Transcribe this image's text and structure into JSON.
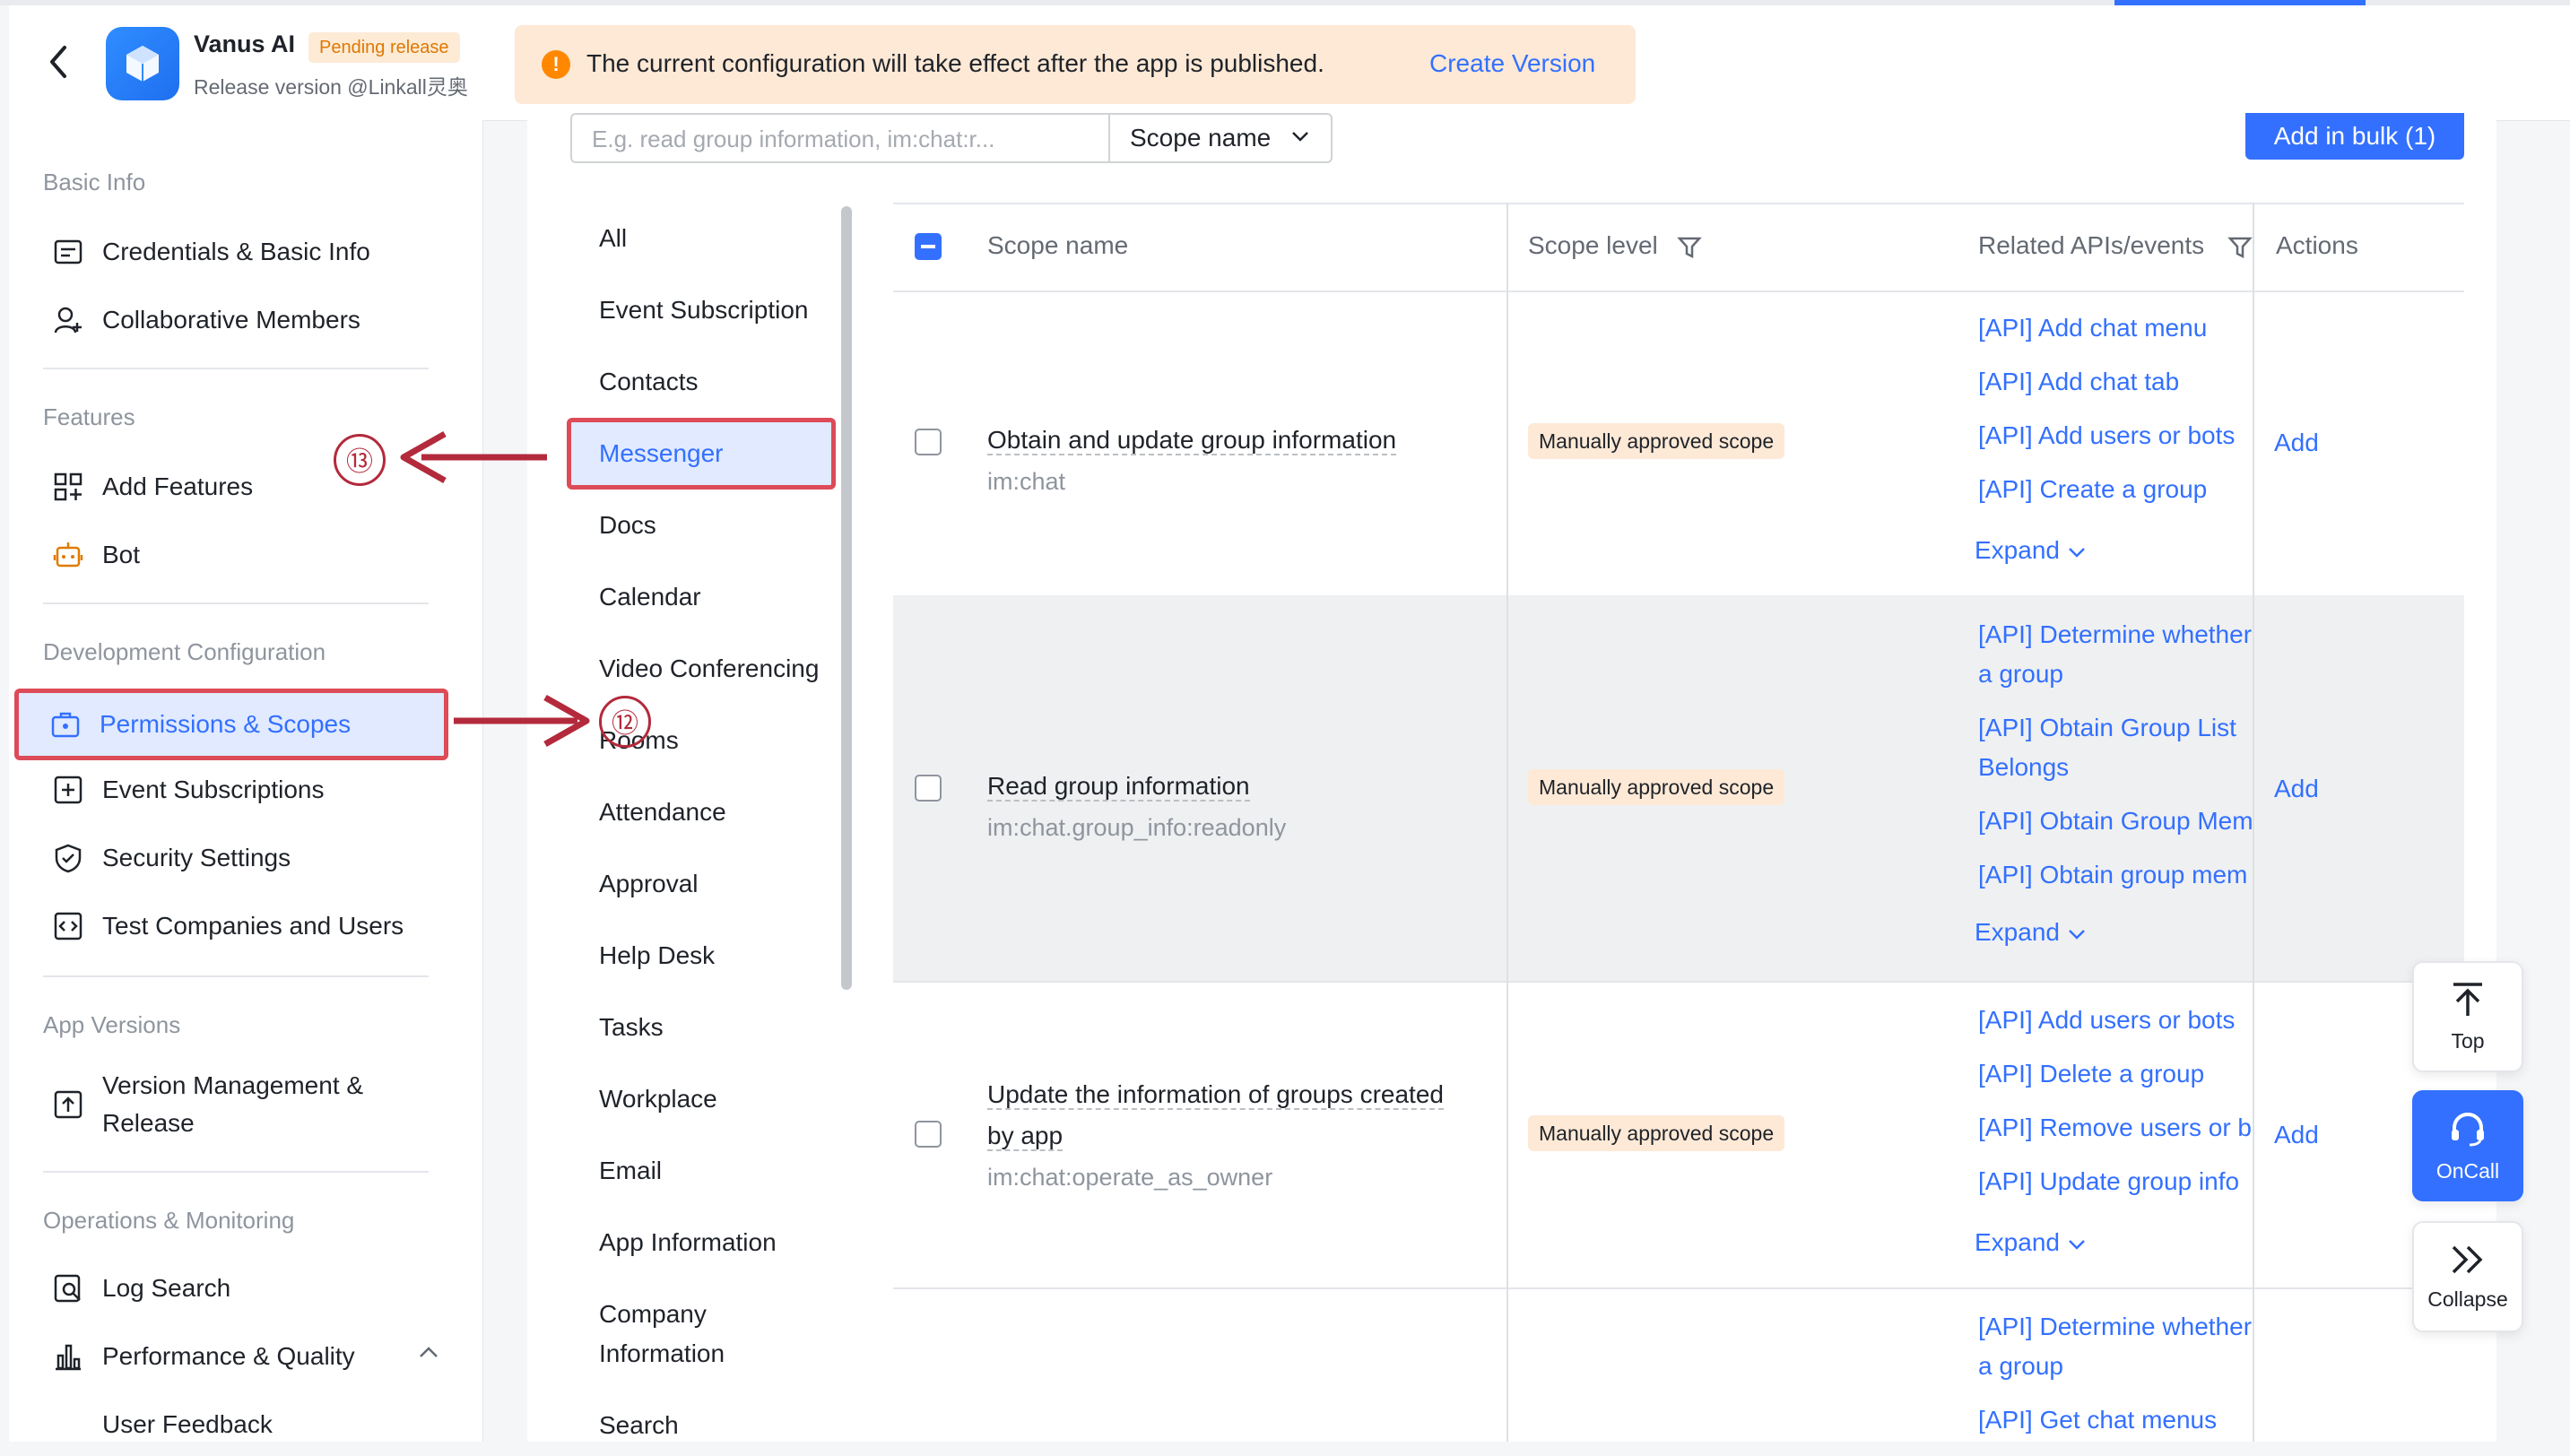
{
  "header": {
    "app_name": "Vanus AI",
    "status_badge": "Pending release",
    "release_info": "Release version @Linkall灵奥",
    "notice": "The current configuration will take effect after the app is published.",
    "create_version": "Create Version"
  },
  "sidebar": {
    "sections": [
      {
        "title": "Basic Info",
        "items": [
          {
            "label": "Credentials & Basic Info",
            "icon": "credentials-icon"
          },
          {
            "label": "Collaborative Members",
            "icon": "add-member-icon"
          }
        ]
      },
      {
        "title": "Features",
        "items": [
          {
            "label": "Add Features",
            "icon": "add-features-icon"
          },
          {
            "label": "Bot",
            "icon": "bot-icon"
          }
        ]
      },
      {
        "title": "Development Configuration",
        "items": [
          {
            "label": "Permissions & Scopes",
            "icon": "permissions-icon",
            "selected": true
          },
          {
            "label": "Event Subscriptions",
            "icon": "event-subscriptions-icon"
          },
          {
            "label": "Security Settings",
            "icon": "shield-icon"
          },
          {
            "label": "Test Companies and Users",
            "icon": "test-companies-icon"
          }
        ]
      },
      {
        "title": "App Versions",
        "items": [
          {
            "label": "Version Management & Release",
            "icon": "upload-icon"
          }
        ]
      },
      {
        "title": "Operations & Monitoring",
        "items": [
          {
            "label": "Log Search",
            "icon": "log-search-icon"
          },
          {
            "label": "Performance & Quality",
            "icon": "bar-chart-icon"
          },
          {
            "label": "User Feedback",
            "icon": ""
          }
        ]
      }
    ]
  },
  "filters": {
    "search_placeholder": "E.g. read group information, im:chat:r...",
    "scope_select": "Scope name",
    "add_bulk": "Add in bulk (1)"
  },
  "categories": [
    "All",
    "Event Subscription",
    "Contacts",
    "Messenger",
    "Docs",
    "Calendar",
    "Video Conferencing",
    "Rooms",
    "Attendance",
    "Approval",
    "Help Desk",
    "Tasks",
    "Workplace",
    "Email",
    "App Information",
    "Company Information",
    "Search"
  ],
  "selected_category": "Messenger",
  "table": {
    "headers": {
      "scope_name": "Scope name",
      "scope_level": "Scope level",
      "related": "Related APIs/events",
      "actions": "Actions"
    },
    "rows": [
      {
        "name": "Obtain and update group information",
        "code": "im:chat",
        "level": "Manually approved scope",
        "apis": [
          "[API] Add chat menu",
          "[API] Add chat tab",
          "[API] Add users or bots",
          "[API] Create a group"
        ],
        "expand": "Expand",
        "action": "Add"
      },
      {
        "name": "Read group information",
        "code": "im:chat.group_info:readonly",
        "level": "Manually approved scope",
        "apis": [
          "[API] Determine whether",
          "a group",
          "[API] Obtain Group List",
          "Belongs",
          "[API] Obtain Group Mem",
          "[API] Obtain group mem"
        ],
        "expand": "Expand",
        "action": "Add"
      },
      {
        "name": "Update the information of groups created by app",
        "code": "im:chat:operate_as_owner",
        "level": "Manually approved scope",
        "apis": [
          "[API] Add users or bots",
          "[API] Delete a group",
          "[API] Remove users or b",
          "[API] Update group info"
        ],
        "expand": "Expand",
        "action": "Add"
      },
      {
        "name": "",
        "code": "",
        "level": "",
        "apis": [
          "[API] Determine whether",
          "a group",
          "[API] Get chat menus"
        ],
        "expand": "",
        "action": ""
      }
    ]
  },
  "annotations": {
    "a13": "⑬",
    "a12": "⑫"
  },
  "floating": {
    "top": "Top",
    "oncall": "OnCall",
    "collapse": "Collapse"
  },
  "colors": {
    "accent": "#3370ff",
    "annotation": "#b32a3c",
    "badge_bg": "#fdebd6",
    "banner_bg": "#fde9d6"
  }
}
